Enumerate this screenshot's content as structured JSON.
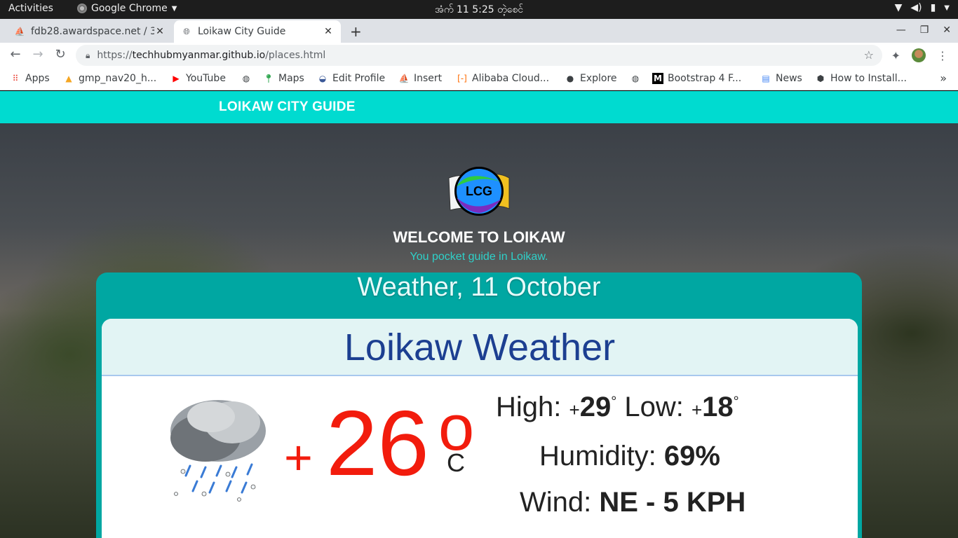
{
  "system": {
    "activities": "Activities",
    "app_name": "Google Chrome",
    "clock": "အံက် 11   5:25 တဲ့စေင်"
  },
  "tabs": [
    {
      "title": "fdb28.awardspace.net / 3",
      "active": false
    },
    {
      "title": "Loikaw City Guide",
      "active": true
    }
  ],
  "omnibox": {
    "scheme": "https://",
    "host": "techhubmyanmar.github.io",
    "path": "/places.html"
  },
  "bookmarks": [
    {
      "label": "Apps",
      "icon": "apps-grid-icon"
    },
    {
      "label": "gmp_nav20_h...",
      "icon": "firebase-icon"
    },
    {
      "label": "YouTube",
      "icon": "youtube-icon"
    },
    {
      "label": "",
      "icon": "globe-icon"
    },
    {
      "label": "Maps",
      "icon": "maps-pin-icon"
    },
    {
      "label": "Edit Profile",
      "icon": "profile-icon"
    },
    {
      "label": "Insert",
      "icon": "pma-icon"
    },
    {
      "label": "Alibaba Cloud...",
      "icon": "alibaba-icon"
    },
    {
      "label": "Explore",
      "icon": "github-icon"
    },
    {
      "label": "",
      "icon": "globe-icon"
    },
    {
      "label": "Bootstrap 4 F...",
      "icon": "medium-icon"
    },
    {
      "label": "News",
      "icon": "google-news-icon"
    },
    {
      "label": "How to Install...",
      "icon": "hex-icon"
    }
  ],
  "site": {
    "brand": "LOIKAW CITY GUIDE",
    "logo_text": "LCG",
    "welcome": "WELCOME TO LOIKAW",
    "tagline": "You pocket guide in Loikaw."
  },
  "weather": {
    "header": "Weather, 11 October",
    "title": "Loikaw Weather",
    "temp_sign": "+",
    "temp": "26",
    "temp_deg": "o",
    "temp_unit": "C",
    "high_label": "High:",
    "high_value": "29",
    "low_label": "Low:",
    "low_value": "18",
    "humidity_label": "Humidity:",
    "humidity_value": "69%",
    "wind_label": "Wind:",
    "wind_value": "NE - 5 KPH"
  },
  "colors": {
    "nav_bg": "#00dbd0",
    "card_bg": "#00a7a2",
    "temp_red": "#f21c0d",
    "title_blue": "#1c3f91"
  }
}
